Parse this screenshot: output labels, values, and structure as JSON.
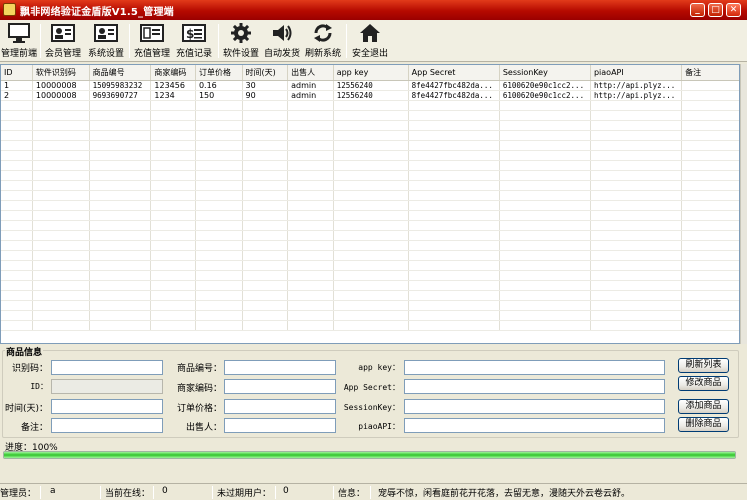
{
  "window": {
    "title": "飘非网络验证金盾版V1.5_管理端"
  },
  "toolbar": {
    "items": [
      {
        "label": "管理前端",
        "icon": "monitor-icon"
      },
      {
        "label": "会员管理",
        "icon": "id-card-icon"
      },
      {
        "label": "系统设置",
        "icon": "id-card-icon"
      },
      {
        "label": "充值管理",
        "icon": "card-list-icon"
      },
      {
        "label": "充值记录",
        "icon": "dollar-list-icon"
      },
      {
        "label": "软件设置",
        "icon": "gear-icon"
      },
      {
        "label": "自动发货",
        "icon": "speaker-icon"
      },
      {
        "label": "刷新系统",
        "icon": "refresh-icon"
      },
      {
        "label": "安全退出",
        "icon": "home-icon"
      }
    ]
  },
  "grid": {
    "columns": [
      "ID",
      "软件识别码",
      "商品编号",
      "商家编码",
      "订单价格",
      "时间(天)",
      "出售人",
      "app key",
      "App Secret",
      "SessionKey",
      "piaoAPI",
      "备注"
    ],
    "rows": [
      [
        "1",
        "10000008",
        "15095983232",
        "123456",
        "0.16",
        "30",
        "admin",
        "12556240",
        "8fe4427fbc482da...",
        "6100620e90c1cc2...",
        "http://api.plyz...",
        ""
      ],
      [
        "2",
        "10000008",
        "9693690727",
        "1234",
        "150",
        "90",
        "admin",
        "12556240",
        "8fe4427fbc482da...",
        "6100620e90c1cc2...",
        "http://api.plyz...",
        ""
      ]
    ]
  },
  "form": {
    "group_title": "商品信息",
    "labels": {
      "code": "识别码：",
      "id": "ID：",
      "days": "时间(天)：",
      "note": "备注：",
      "product_no": "商品编号：",
      "merchant_code": "商家编码：",
      "price": "订单价格：",
      "seller": "出售人：",
      "app_key": "app key：",
      "app_secret": "App Secret：",
      "session_key": "SessionKey：",
      "piao_api": "piaoAPI："
    },
    "buttons": {
      "refresh": "刷新列表",
      "edit": "修改商品",
      "add": "添加商品",
      "delete": "删除商品"
    }
  },
  "progress": {
    "label": "进度：100%",
    "value": 1.0
  },
  "statusbar": {
    "admin_label": "管理员：",
    "admin_value": "a",
    "online_label": "当前在线：",
    "online_value": "0",
    "unexpired_label": "未过期用户：",
    "unexpired_value": "0",
    "info_label": "信息：",
    "info_value": "宠辱不惊，闲看庭前花开花落，去留无意，漫随天外云卷云舒。"
  },
  "colors": {
    "titlebar": "#c01200",
    "progress": "#31c52c"
  }
}
